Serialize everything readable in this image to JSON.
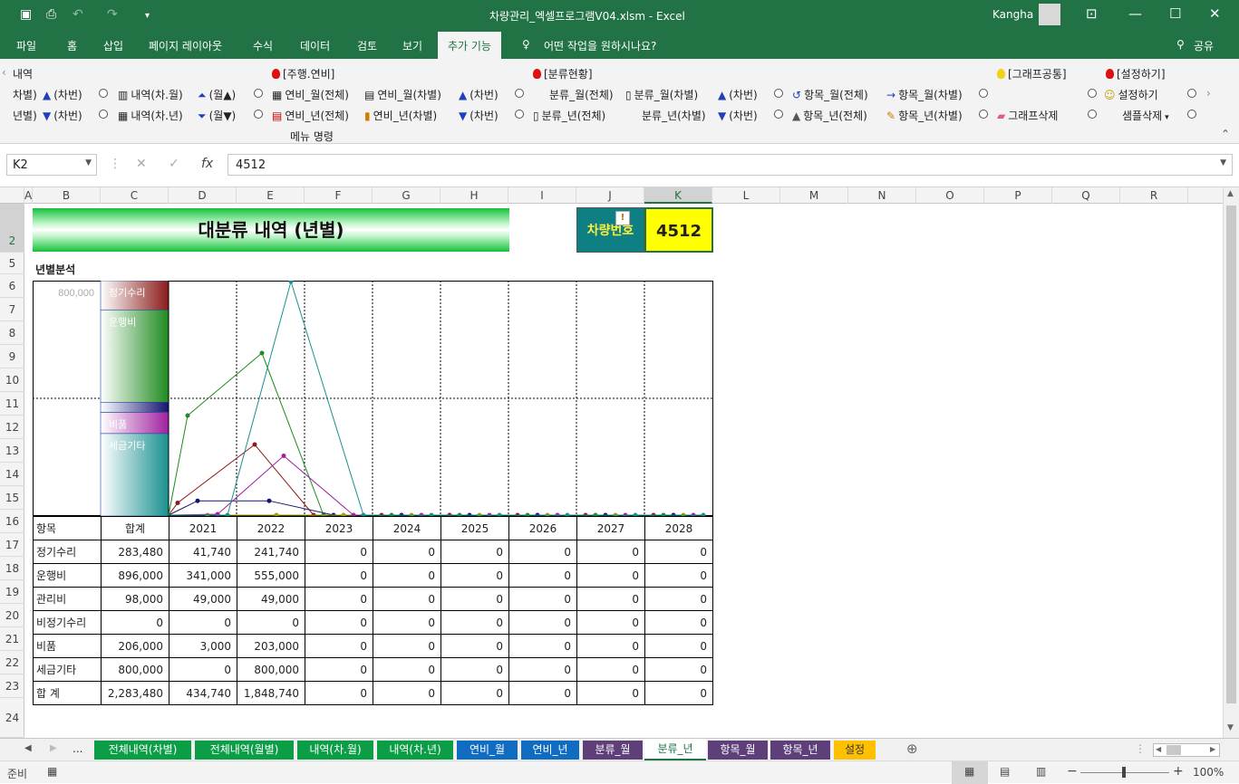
{
  "window": {
    "title": "차량관리_엑셀프로그램V04.xlsm  -  Excel",
    "user": "Kangha",
    "search": "어떤 작업을 원하시나요?",
    "share": "공유"
  },
  "tabs": [
    "파일",
    "홈",
    "삽입",
    "페이지 레이아웃",
    "수식",
    "데이터",
    "검토",
    "보기",
    "추가 기능"
  ],
  "ribbon": {
    "group_label": "메뉴 명령",
    "headers": [
      "내역",
      "[주행.연비]",
      "[분류현황]",
      "[그래프공통]",
      "[설정하기]"
    ],
    "row1": [
      "차별)",
      "(차번)",
      "내역(차.월)",
      "(월▲)",
      "연비_월(전체)",
      "연비_월(차별)",
      "(차번)",
      "분류_월(전체)",
      "분류_월(차별)",
      "(차번)",
      "항목_월(전체)",
      "항목_월(차별)",
      "설정하기"
    ],
    "row2": [
      "년별)",
      "(차번)",
      "내역(차.년)",
      "(월▼)",
      "연비_년(전체)",
      "연비_년(차별)",
      "(차번)",
      "분류_년(전체)",
      "분류_년(차별)",
      "(차번)",
      "항목_년(전체)",
      "항목_년(차별)",
      "그래프삭제",
      "샘플삭제"
    ]
  },
  "formula_bar": {
    "name_box": "K2",
    "formula": "4512",
    "fx": "fx"
  },
  "columns": [
    "A",
    "B",
    "C",
    "D",
    "E",
    "F",
    "G",
    "H",
    "I",
    "J",
    "K",
    "L",
    "M",
    "N",
    "O",
    "P",
    "Q",
    "R"
  ],
  "rows": [
    "2",
    "5",
    "6",
    "7",
    "8",
    "9",
    "10",
    "11",
    "12",
    "13",
    "14",
    "15",
    "16",
    "17",
    "18",
    "19",
    "20",
    "21",
    "22",
    "23",
    "24"
  ],
  "sheet": {
    "banner_title": "대분류 내역 (년별)",
    "vehicle_label": "차량번호",
    "vehicle_number": "4512",
    "section_title": "년별분석",
    "table": {
      "header": [
        "항목",
        "합계",
        "2021",
        "2022",
        "2023",
        "2024",
        "2025",
        "2026",
        "2027",
        "2028"
      ],
      "rows": [
        [
          "정기수리",
          "283,480",
          "41,740",
          "241,740",
          "0",
          "0",
          "0",
          "0",
          "0",
          "0"
        ],
        [
          "운행비",
          "896,000",
          "341,000",
          "555,000",
          "0",
          "0",
          "0",
          "0",
          "0",
          "0"
        ],
        [
          "관리비",
          "98,000",
          "49,000",
          "49,000",
          "0",
          "0",
          "0",
          "0",
          "0",
          "0"
        ],
        [
          "비정기수리",
          "0",
          "0",
          "0",
          "0",
          "0",
          "0",
          "0",
          "0",
          "0"
        ],
        [
          "비품",
          "206,000",
          "3,000",
          "203,000",
          "0",
          "0",
          "0",
          "0",
          "0",
          "0"
        ],
        [
          "세금기타",
          "800,000",
          "0",
          "800,000",
          "0",
          "0",
          "0",
          "0",
          "0",
          "0"
        ],
        [
          "합 계",
          "2,283,480",
          "434,740",
          "1,848,740",
          "0",
          "0",
          "0",
          "0",
          "0",
          "0"
        ]
      ]
    }
  },
  "chart_data": {
    "type": "line",
    "y_axis_label": "800,000",
    "ylim": [
      0,
      800000
    ],
    "categories": [
      "2021",
      "2022",
      "2023",
      "2024",
      "2025",
      "2026",
      "2027",
      "2028"
    ],
    "colors": [
      "#8b1a1a",
      "#1f8a1f",
      "#14146e",
      "#a0a000",
      "#a020a0",
      "#1a9090"
    ],
    "series": [
      {
        "name": "정기수리",
        "values": [
          41740,
          241740,
          0,
          0,
          0,
          0,
          0,
          0
        ]
      },
      {
        "name": "운행비",
        "values": [
          341000,
          555000,
          0,
          0,
          0,
          0,
          0,
          0
        ]
      },
      {
        "name": "관리비",
        "values": [
          49000,
          49000,
          0,
          0,
          0,
          0,
          0,
          0
        ]
      },
      {
        "name": "비정기수리",
        "values": [
          0,
          0,
          0,
          0,
          0,
          0,
          0,
          0
        ]
      },
      {
        "name": "비품",
        "values": [
          3000,
          203000,
          0,
          0,
          0,
          0,
          0,
          0
        ]
      },
      {
        "name": "세금기타",
        "values": [
          0,
          800000,
          0,
          0,
          0,
          0,
          0,
          0
        ]
      }
    ],
    "stack": [
      {
        "name": "정기수리",
        "value": 283480
      },
      {
        "name": "운행비",
        "value": 896000
      },
      {
        "name": "관리비",
        "value": 98000
      },
      {
        "name": "비정기수리",
        "value": 0
      },
      {
        "name": "비품",
        "value": 206000
      },
      {
        "name": "세금기타",
        "value": 800000
      }
    ]
  },
  "sheet_tabs": [
    {
      "label": "전체내역(차별)",
      "color": "#0b9e47"
    },
    {
      "label": "전체내역(월별)",
      "color": "#0b9e47"
    },
    {
      "label": "내역(차.월)",
      "color": "#0b9e47"
    },
    {
      "label": "내역(차.년)",
      "color": "#0b9e47"
    },
    {
      "label": "연비_월",
      "color": "#0f6cc0"
    },
    {
      "label": "연비_년",
      "color": "#0f6cc0"
    },
    {
      "label": "분류_월",
      "color": "#5e3f7a"
    },
    {
      "label": "분류_년",
      "color": "#ffffff"
    },
    {
      "label": "항목_월",
      "color": "#5e3f7a"
    },
    {
      "label": "항목_년",
      "color": "#5e3f7a"
    },
    {
      "label": "설정",
      "color": "#ffc000"
    }
  ],
  "status": {
    "ready": "준비",
    "zoom": "100%"
  }
}
